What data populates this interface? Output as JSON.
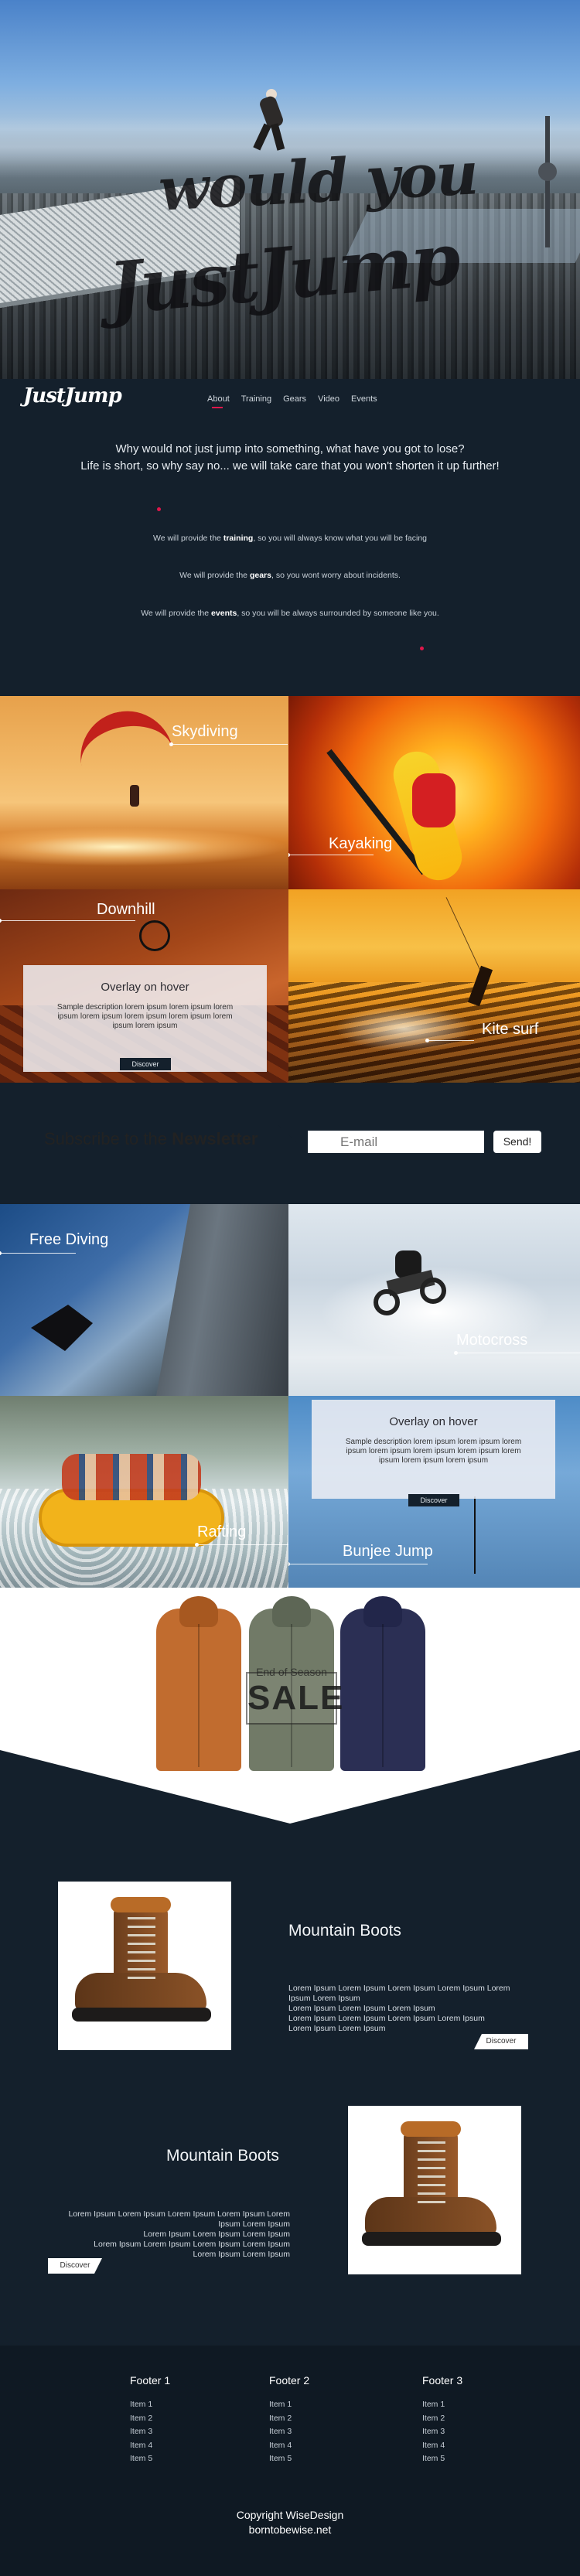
{
  "hero": {
    "headline_line1": "would you",
    "headline_line2": "JustJump"
  },
  "logo": "JustJump",
  "nav": {
    "items": [
      "About",
      "Training",
      "Gears",
      "Video",
      "Events"
    ],
    "active": "About"
  },
  "intro": {
    "line1": "Why would not just jump into something, what have you got to lose?",
    "line2": "Life is short, so why say no... we will take care that you won't shorten it up further!"
  },
  "services": [
    {
      "pre": "We will provide the ",
      "bold": "training",
      "post": ", so you will always know what you will be facing"
    },
    {
      "pre": "We will provide the ",
      "bold": "gears",
      "post": ", so you wont worry about incidents."
    },
    {
      "pre": "We will provide the ",
      "bold": "events",
      "post": ", so you will be always surrounded by someone like you."
    }
  ],
  "activities_1": {
    "skydiving": "Skydiving",
    "kayaking": "Kayaking",
    "downhill": "Downhill",
    "kitesurf": "Kite surf",
    "overlay": {
      "title": "Overlay on hover",
      "desc": "Sample description lorem ipsum lorem ipsum lorem ipsum lorem ipsum lorem ipsum lorem ipsum lorem ipsum lorem ipsum",
      "button": "Discover"
    }
  },
  "newsletter": {
    "text": "Subscribe to the ",
    "bold": "Newsletter",
    "placeholder": "E-mail",
    "button": "Send!"
  },
  "activities_2": {
    "freediving": "Free Diving",
    "motocross": "Motocross",
    "rafting": "Rafting",
    "bunjee": "Bunjee Jump",
    "overlay": {
      "title": "Overlay on hover",
      "desc": "Sample description lorem ipsum lorem ipsum lorem ipsum lorem ipsum lorem ipsum lorem ipsum lorem ipsum lorem ipsum lorem ipsum",
      "button": "Discover"
    }
  },
  "sale": {
    "subtitle": "End of Season",
    "title": "SALE"
  },
  "products": [
    {
      "title": "Mountain Boots",
      "desc": [
        "Lorem Ipsum Lorem Ipsum Lorem Ipsum Lorem Ipsum Lorem",
        "Ipsum Lorem Ipsum",
        "Lorem Ipsum Lorem Ipsum Lorem Ipsum",
        "Lorem Ipsum Lorem Ipsum Lorem Ipsum Lorem Ipsum",
        "Lorem Ipsum Lorem Ipsum"
      ],
      "button": "Discover"
    },
    {
      "title": "Mountain Boots",
      "desc": [
        "Lorem Ipsum Lorem Ipsum Lorem Ipsum Lorem Ipsum Lorem",
        "Ipsum Lorem Ipsum",
        "Lorem Ipsum Lorem Ipsum Lorem Ipsum",
        "Lorem Ipsum Lorem Ipsum Lorem Ipsum Lorem Ipsum",
        "Lorem Ipsum Lorem Ipsum"
      ],
      "button": "Discover"
    }
  ],
  "footer": {
    "columns": [
      {
        "title": "Footer 1",
        "items": [
          "Item 1",
          "Item 2",
          "Item 3",
          "Item 4",
          "Item 5"
        ]
      },
      {
        "title": "Footer 2",
        "items": [
          "Item 1",
          "Item 2",
          "Item 3",
          "Item 4",
          "Item 5"
        ]
      },
      {
        "title": "Footer 3",
        "items": [
          "Item 1",
          "Item 2",
          "Item 3",
          "Item 4",
          "Item 5"
        ]
      }
    ],
    "copyright": "Copyright WiseDesign",
    "site": "borntobewise.net"
  },
  "colors": {
    "background": "#14202c",
    "accent": "#e0174b",
    "footer": "#0f1923"
  }
}
